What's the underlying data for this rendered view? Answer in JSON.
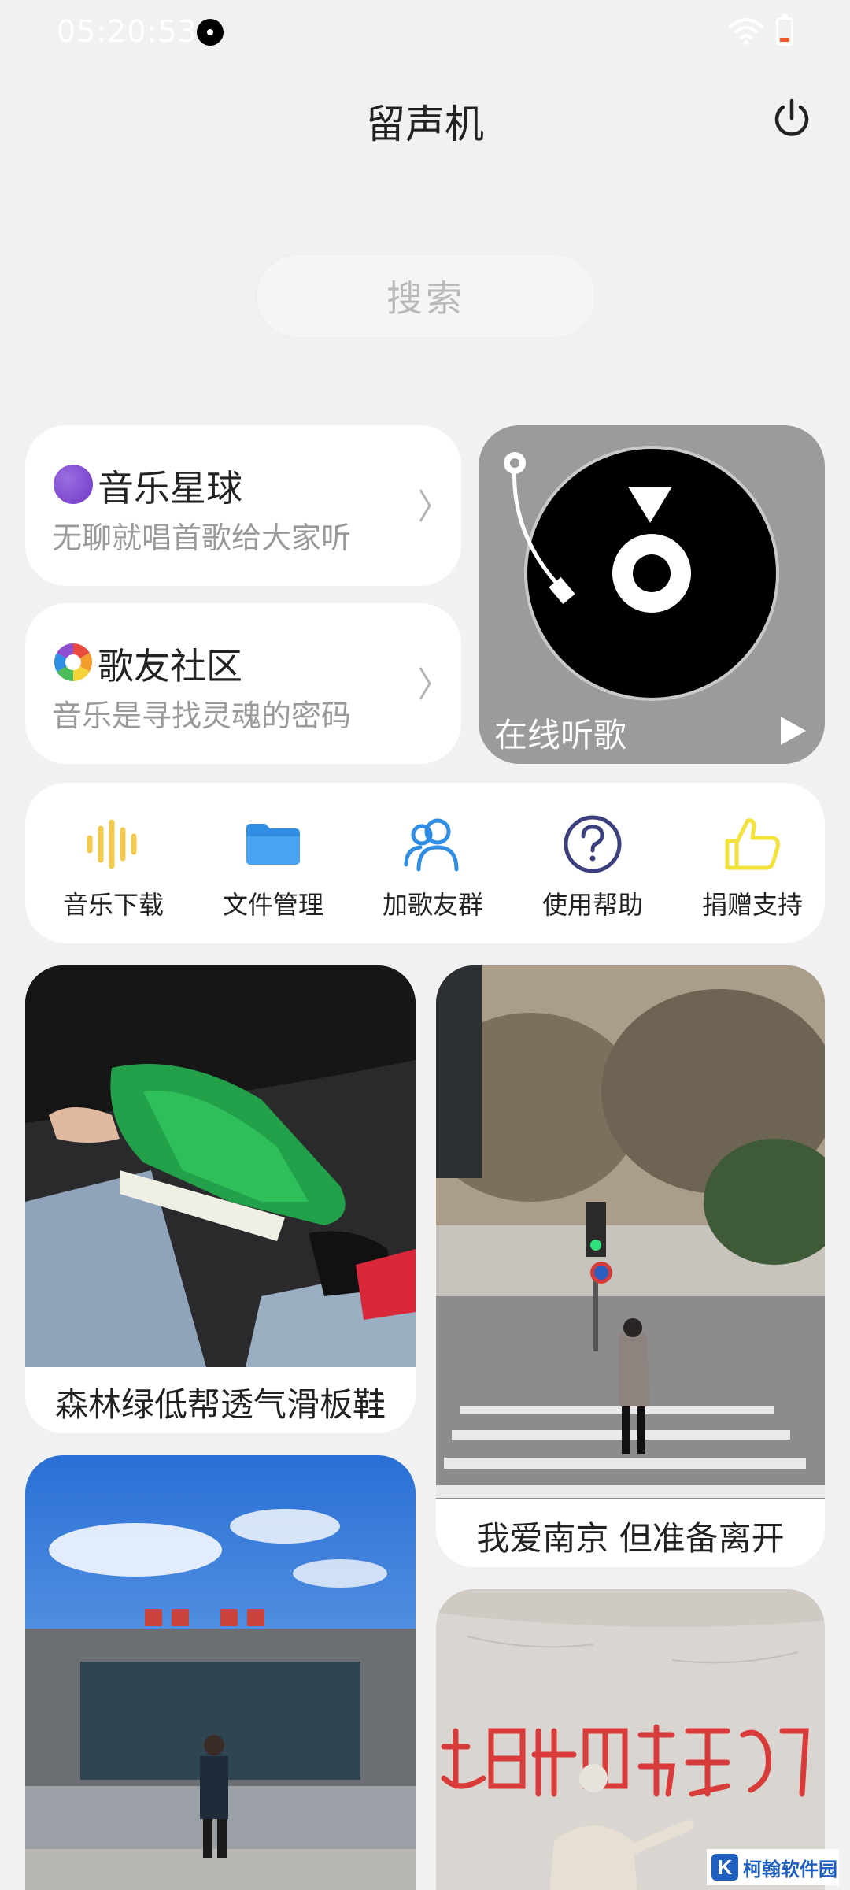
{
  "status_bar": {
    "time": "05:20:53",
    "icons": [
      "app-record-icon",
      "wifi-icon",
      "battery-icon"
    ]
  },
  "header": {
    "title": "留声机",
    "power_icon": "power-icon"
  },
  "search": {
    "placeholder": "搜索"
  },
  "feature_cards": {
    "planet": {
      "title": "音乐星球",
      "subtitle": "无聊就唱首歌给大家听",
      "icon": "planet-icon"
    },
    "community": {
      "title": "歌友社区",
      "subtitle": "音乐是寻找灵魂的密码",
      "icon": "aperture-icon"
    },
    "online": {
      "label": "在线听歌",
      "icon": "record-player-icon"
    }
  },
  "tools": [
    {
      "label": "音乐下载",
      "icon": "sound-wave-icon"
    },
    {
      "label": "文件管理",
      "icon": "folder-icon"
    },
    {
      "label": "加歌友群",
      "icon": "group-icon"
    },
    {
      "label": "使用帮助",
      "icon": "help-icon"
    },
    {
      "label": "捐赠支持",
      "icon": "thumbs-up-icon"
    }
  ],
  "feed": [
    {
      "caption": "森林绿低帮透气滑板鞋"
    },
    {
      "caption": "我爱南京 但准备离开"
    },
    {
      "caption": ""
    },
    {
      "caption": ""
    }
  ],
  "colors": {
    "background": "#f1f1f1",
    "card": "#ffffff",
    "online_card": "#9b9b9b",
    "wave_yellow": "#f2c94c",
    "folder_blue": "#2f8de4",
    "group_blue": "#2f8de4",
    "help_navy": "#3c3f7d",
    "thumb_yellow": "#f2e23a"
  },
  "watermark": {
    "logo_letter": "K",
    "text": "柯翰软件园"
  }
}
